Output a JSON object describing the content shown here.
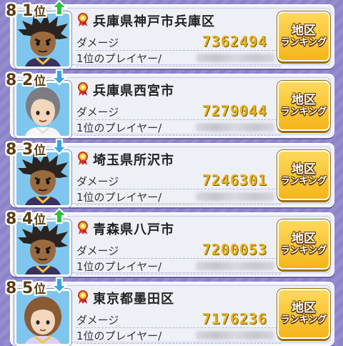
{
  "rankings": [
    {
      "rank": "8 1",
      "suffix": "位",
      "trend": "up",
      "city": "兵庫県神戸市兵庫区",
      "damage": "7362494",
      "avatar": "dark-hair-boy"
    },
    {
      "rank": "8 2",
      "suffix": "位",
      "trend": "down",
      "city": "兵庫県西宮市",
      "damage": "7279044",
      "avatar": "grey-hair-girl"
    },
    {
      "rank": "8 3",
      "suffix": "位",
      "trend": "down",
      "city": "埼玉県所沢市",
      "damage": "7246301",
      "avatar": "dark-hair-boy"
    },
    {
      "rank": "8 4",
      "suffix": "位",
      "trend": "up",
      "city": "青森県八戸市",
      "damage": "7200053",
      "avatar": "dark-hair-boy"
    },
    {
      "rank": "8 5",
      "suffix": "位",
      "trend": "down",
      "city": "東京都墨田区",
      "damage": "7176236",
      "avatar": "brown-hair-girl"
    }
  ],
  "labels": {
    "damage": "ダメージ",
    "top_player": "1位のプレイヤー/"
  },
  "button": {
    "line1": "地区",
    "line2": "ランキング"
  },
  "colors": {
    "up": "#2fbf3a",
    "down": "#35a7e6"
  }
}
